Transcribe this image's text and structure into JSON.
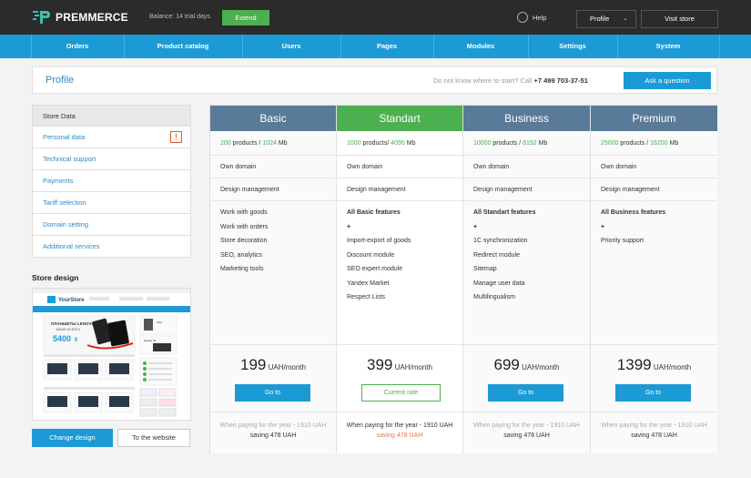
{
  "app": {
    "brand": "PREMMERCE",
    "balance_text": "Balance: 14 trial days",
    "extend_label": "Extend"
  },
  "topbar": {
    "help_label": "Help",
    "profile_label": "Profile",
    "visit_label": "Visit store"
  },
  "nav": {
    "items": [
      "Orders",
      "Product  catalog",
      "Users",
      "Pages",
      "Modules",
      "Settings",
      "System"
    ]
  },
  "profile": {
    "title": "Profile",
    "start_prefix": "Do not know where to start? Call",
    "phone": "+7 499 703-37-51",
    "ask_label": "Ask a question"
  },
  "sidebar": {
    "items": [
      "Store Data",
      "Personal data",
      "Technical support",
      "Payments",
      "Tariff selection",
      "Domain setting",
      "Additional services"
    ],
    "warn_symbol": "!",
    "store_design_title": "Store design",
    "change_label": "Change design",
    "website_label": "To the website"
  },
  "plans": [
    {
      "name": "Basic",
      "color": "#5a7a99",
      "products": "200",
      "products_text": " products / ",
      "storage": "1024",
      "storage_unit": " Mb",
      "domain": "Own domain",
      "design": "Design management",
      "features": [
        {
          "text": "Work with goods",
          "bold": false
        },
        {
          "text": "Work with orders",
          "bold": false
        },
        {
          "text": "Store decoration",
          "bold": false
        },
        {
          "text": "SEO, analytics",
          "bold": false
        },
        {
          "text": "Marketing tools",
          "bold": false
        }
      ],
      "price": "199",
      "unit": " UAH/month",
      "button": "Go to",
      "current": false,
      "yearly": "When paying for the year - 1910 UAH",
      "saving": "saving 478 UAH"
    },
    {
      "name": "Standart",
      "color": "#4caf50",
      "products": "1000",
      "products_text": " products/ ",
      "storage": "4096",
      "storage_unit": " Mb",
      "domain": "Own domain",
      "design": "Design management",
      "features": [
        {
          "text": "All Basic features",
          "bold": true
        },
        {
          "text": "+",
          "bold": true
        },
        {
          "text": "Import-export of goods",
          "bold": false
        },
        {
          "text": "Discount module",
          "bold": false
        },
        {
          "text": "SEO expert module",
          "bold": false
        },
        {
          "text": "Yandex Market",
          "bold": false
        },
        {
          "text": "Respect Lists",
          "bold": false
        }
      ],
      "price": "399",
      "unit": " UAH/month",
      "button": "Current rate",
      "current": true,
      "yearly": "When paying for the year - 1910 UAH",
      "saving": "saving 478 UAH"
    },
    {
      "name": "Business",
      "color": "#5a7a99",
      "products": "10000",
      "products_text": " products / ",
      "storage": "8192",
      "storage_unit": " Mb",
      "domain": "Own domain",
      "design": "Design management",
      "features": [
        {
          "text": "All Standart features",
          "bold": true
        },
        {
          "text": "+",
          "bold": true
        },
        {
          "text": "1C synchronization",
          "bold": false
        },
        {
          "text": "Redirect module",
          "bold": false
        },
        {
          "text": "Sitemap",
          "bold": false
        },
        {
          "text": "Manage user data",
          "bold": false
        },
        {
          "text": "Multilingualism",
          "bold": false
        }
      ],
      "price": "699",
      "unit": " UAH/month",
      "button": "Go to",
      "current": false,
      "yearly": "When paying for the year - 1910 UAH",
      "saving": "saving 478 UAH"
    },
    {
      "name": "Premium",
      "color": "#5a7a99",
      "products": "25000",
      "products_text": " products / ",
      "storage": "16200",
      "storage_unit": " Mb",
      "domain": "Own domain",
      "design": "Design management",
      "features": [
        {
          "text": "All Business features",
          "bold": true
        },
        {
          "text": "+",
          "bold": true
        },
        {
          "text": "Priority support",
          "bold": false
        }
      ],
      "price": "1399",
      "unit": " UAH/month",
      "button": "Go to",
      "current": false,
      "yearly": "When paying for the year - 1910 UAH",
      "saving": "saving 478 UAH"
    }
  ],
  "thumbnail": {
    "store_name": "YourStore",
    "banner_title": "ПЛАНШЕТЫ LENOVO",
    "banner_sub": "ВАШЕ ИЗ ВСЕХ",
    "banner_price": "5400",
    "banner_currency": "₴",
    "side_label_1": "iPad",
    "side_label_2": "Explay N1"
  }
}
